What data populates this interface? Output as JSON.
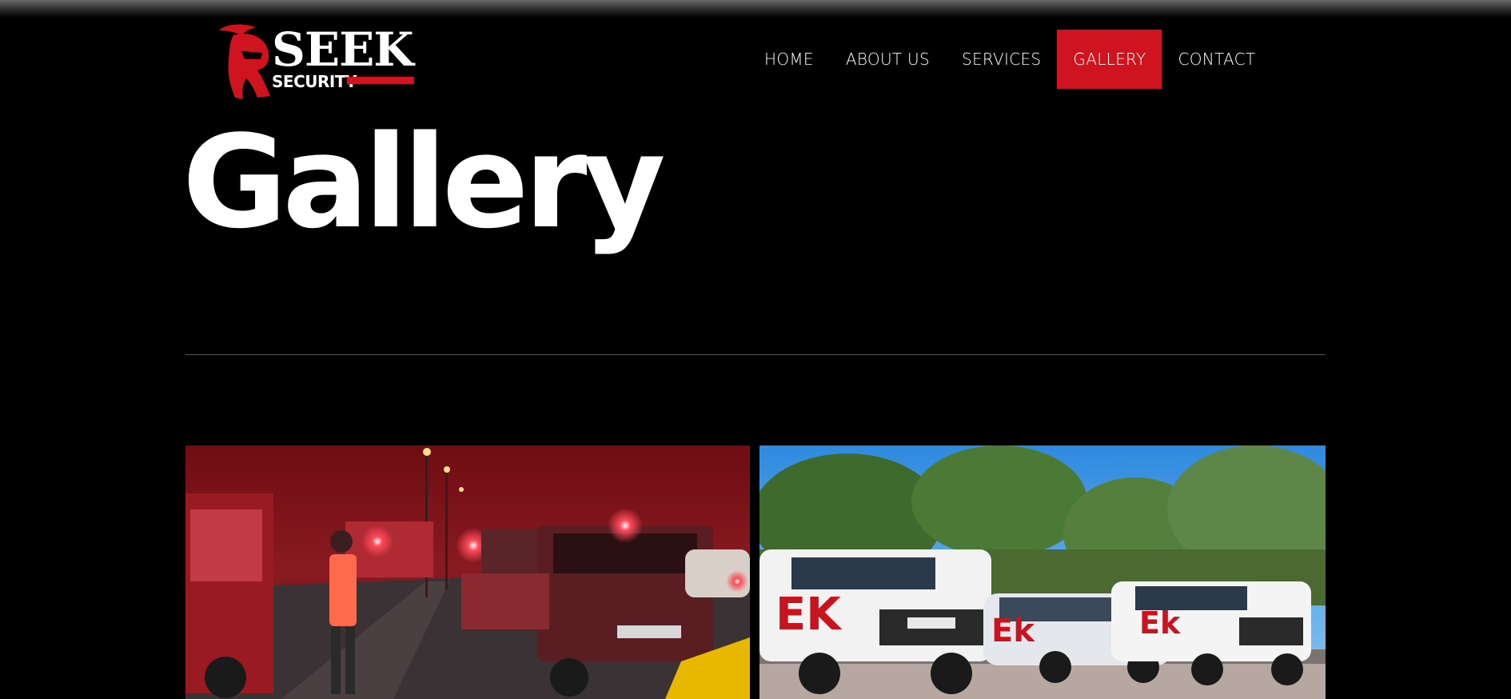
{
  "header": {
    "logo": {
      "word": "SEEK",
      "sub": "SECURITY"
    },
    "nav": [
      {
        "label": "HOME",
        "active": false
      },
      {
        "label": "ABOUT US",
        "active": false
      },
      {
        "label": "SERVICES",
        "active": false
      },
      {
        "label": "GALLERY",
        "active": true
      },
      {
        "label": "CONTACT",
        "active": false
      }
    ]
  },
  "main": {
    "title": "Gallery"
  },
  "colors": {
    "brand_red": "#d0141f",
    "background": "#000000"
  }
}
